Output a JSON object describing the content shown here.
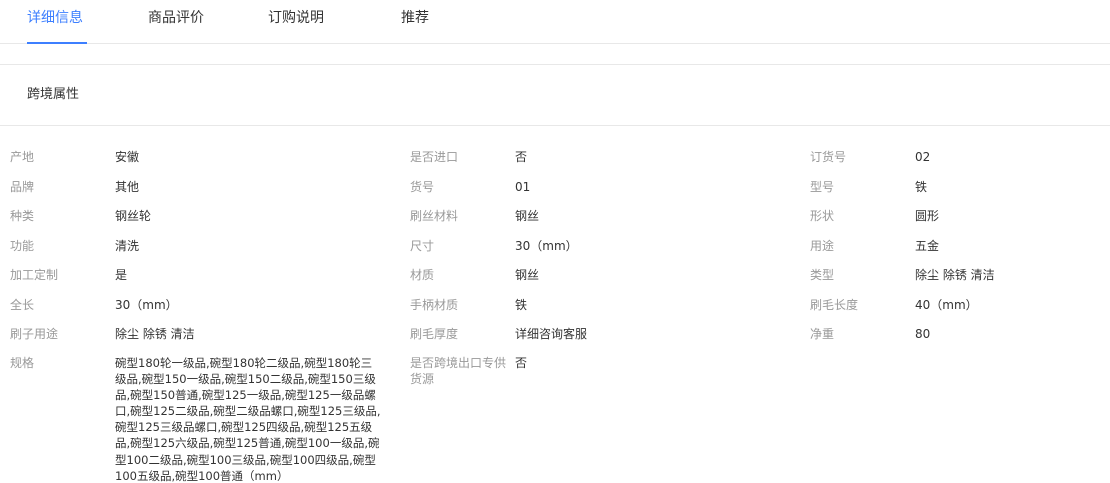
{
  "tabs": [
    {
      "label": "详细信息",
      "active": true
    },
    {
      "label": "商品评价",
      "active": false
    },
    {
      "label": "订购说明",
      "active": false
    },
    {
      "label": "推荐",
      "active": false
    }
  ],
  "section_title": "跨境属性",
  "colors": {
    "accent": "#3d7fff",
    "label": "#999999",
    "value": "#333333",
    "divider": "#e8e8e8"
  },
  "attributes": {
    "origin": {
      "label": "产地",
      "value": "安徽"
    },
    "imported": {
      "label": "是否进口",
      "value": "否"
    },
    "order_no": {
      "label": "订货号",
      "value": "02"
    },
    "brand": {
      "label": "品牌",
      "value": "其他"
    },
    "item_no": {
      "label": "货号",
      "value": "01"
    },
    "model": {
      "label": "型号",
      "value": "铁"
    },
    "kind": {
      "label": "种类",
      "value": "钢丝轮"
    },
    "bristle_material": {
      "label": "刷丝材料",
      "value": "钢丝"
    },
    "shape": {
      "label": "形状",
      "value": "圆形"
    },
    "function": {
      "label": "功能",
      "value": "清洗"
    },
    "size": {
      "label": "尺寸",
      "value": "30（mm）"
    },
    "usage": {
      "label": "用途",
      "value": "五金"
    },
    "custom": {
      "label": "加工定制",
      "value": "是"
    },
    "material": {
      "label": "材质",
      "value": "钢丝"
    },
    "type": {
      "label": "类型",
      "value": "除尘 除锈 清洁"
    },
    "length": {
      "label": "全长",
      "value": "30（mm）"
    },
    "handle_material": {
      "label": "手柄材质",
      "value": "铁"
    },
    "bristle_length": {
      "label": "刷毛长度",
      "value": "40（mm）"
    },
    "brush_usage": {
      "label": "刷子用途",
      "value": "除尘 除锈 清洁"
    },
    "bristle_thickness": {
      "label": "刷毛厚度",
      "value": "详细咨询客服"
    },
    "net_weight": {
      "label": "净重",
      "value": "80"
    },
    "spec": {
      "label": "规格",
      "value": "碗型180轮一级品,碗型180轮二级品,碗型180轮三级品,碗型150一级品,碗型150二级品,碗型150三级品,碗型150普通,碗型125一级品,碗型125一级品螺口,碗型125二级品,碗型二级品螺口,碗型125三级品,碗型125三级品螺口,碗型125四级品,碗型125五级品,碗型125六级品,碗型125普通,碗型100一级品,碗型100二级品,碗型100三级品,碗型100四级品,碗型100五级品,碗型100普通（mm）"
    },
    "cross_border": {
      "label": "是否跨境出口专供货源",
      "value": "否"
    }
  }
}
